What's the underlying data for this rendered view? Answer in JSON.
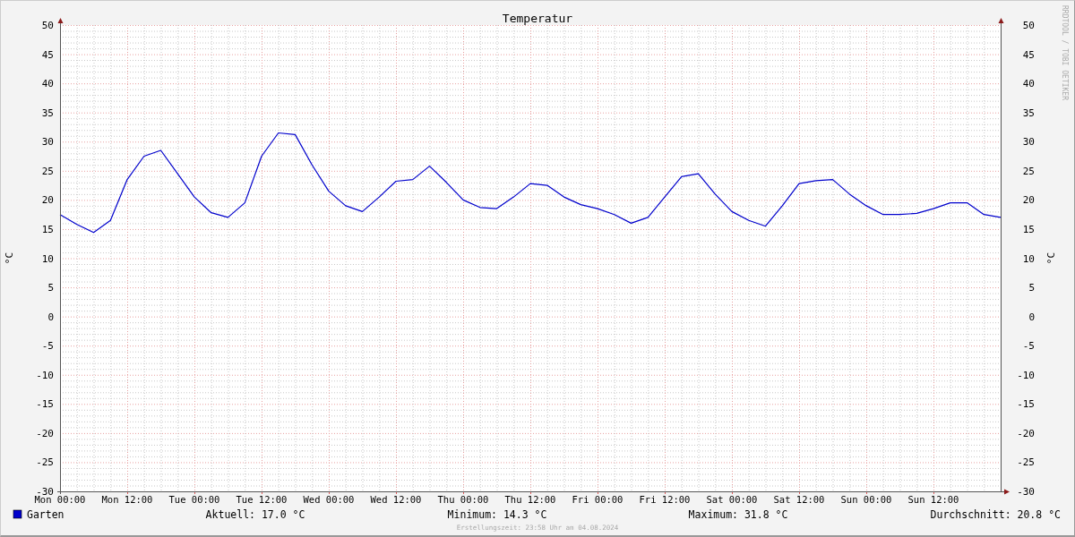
{
  "graph": {
    "watermark": "RRDTOOL / TOBI OETIKER",
    "chart_data": {
      "type": "line",
      "title": "Temperatur",
      "ylabel": "°C",
      "ylim": [
        -30,
        50
      ],
      "grid": true,
      "categories": [
        "Mon 00:00",
        null,
        null,
        null,
        "Mon 12:00",
        null,
        null,
        null,
        "Tue 00:00",
        null,
        null,
        null,
        "Tue 12:00",
        null,
        null,
        null,
        "Wed 00:00",
        null,
        null,
        null,
        "Wed 12:00",
        null,
        null,
        null,
        "Thu 00:00",
        null,
        null,
        null,
        "Thu 12:00",
        null,
        null,
        null,
        "Fri 00:00",
        null,
        null,
        null,
        "Fri 12:00",
        null,
        null,
        null,
        "Sat 00:00",
        null,
        null,
        null,
        "Sat 12:00",
        null,
        null,
        null,
        "Sun 00:00",
        null,
        null,
        null,
        "Sun 12:00",
        null,
        null,
        null,
        null
      ],
      "series": [
        {
          "name": "Garten",
          "color": "#0000cc",
          "values": [
            17.5,
            15.8,
            14.4,
            16.5,
            23.5,
            27.5,
            28.5,
            24.5,
            20.5,
            17.8,
            17.0,
            19.5,
            27.5,
            31.5,
            31.2,
            26,
            21.5,
            19,
            18,
            20.5,
            23.2,
            23.5,
            25.8,
            23,
            20,
            18.7,
            18.5,
            20.5,
            22.8,
            22.5,
            20.5,
            19.2,
            18.5,
            17.5,
            16,
            17,
            20.5,
            24,
            24.5,
            21,
            18,
            16.5,
            15.5,
            19,
            22.8,
            23.3,
            23.5,
            21,
            19,
            17.5,
            17.5,
            17.7,
            18.5,
            19.5,
            19.5,
            17.5,
            17
          ]
        }
      ],
      "yticks": [
        50,
        45,
        40,
        35,
        30,
        25,
        20,
        15,
        10,
        5,
        0,
        -5,
        -10,
        -15,
        -20,
        -25,
        -30
      ]
    },
    "right_axis": {
      "label": "°C",
      "ticks": [
        "50",
        "45",
        "40",
        "35",
        "30",
        "25",
        "20",
        "15",
        "10",
        "5",
        "0",
        "-5",
        "-10",
        "-15",
        "-20",
        "-25",
        "-30"
      ]
    },
    "legend": {
      "stats": [
        "Aktuell: 17.0 °C",
        "Minimum: 14.3 °C",
        "Maximum: 31.8 °C",
        "Durchschnitt: 20.8 °C"
      ]
    },
    "footer": "Erstellungszeit: 23:58 Uhr am 04.08.2024"
  }
}
